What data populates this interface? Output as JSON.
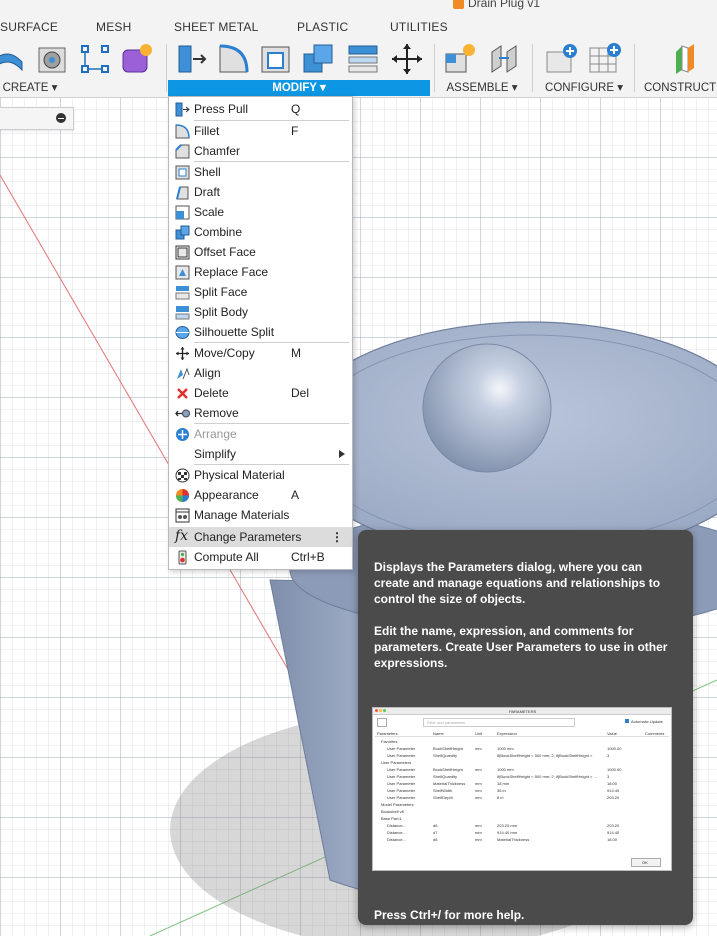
{
  "document": {
    "title": "Drain Plug v1"
  },
  "tabs": [
    "SURFACE",
    "MESH",
    "SHEET METAL",
    "PLASTIC",
    "UTILITIES"
  ],
  "groups": {
    "create": "CREATE ▾",
    "modify": "MODIFY ▾",
    "assemble": "ASSEMBLE ▾",
    "configure": "CONFIGURE ▾",
    "construct": "CONSTRUCT"
  },
  "colors": {
    "accent": "#0d96e3",
    "model": "#a7b6cf",
    "tooltip_bg": "#4b4b4b"
  },
  "menu": {
    "items": [
      {
        "label": "Press Pull",
        "shortcut": "Q",
        "icon": "press-pull-icon"
      },
      {
        "label": "Fillet",
        "shortcut": "F",
        "icon": "fillet-icon"
      },
      {
        "label": "Chamfer",
        "shortcut": "",
        "icon": "chamfer-icon"
      },
      {
        "label": "Shell",
        "shortcut": "",
        "icon": "shell-icon"
      },
      {
        "label": "Draft",
        "shortcut": "",
        "icon": "draft-icon"
      },
      {
        "label": "Scale",
        "shortcut": "",
        "icon": "scale-icon"
      },
      {
        "label": "Combine",
        "shortcut": "",
        "icon": "combine-icon"
      },
      {
        "label": "Offset Face",
        "shortcut": "",
        "icon": "offset-face-icon"
      },
      {
        "label": "Replace Face",
        "shortcut": "",
        "icon": "replace-face-icon"
      },
      {
        "label": "Split Face",
        "shortcut": "",
        "icon": "split-face-icon"
      },
      {
        "label": "Split Body",
        "shortcut": "",
        "icon": "split-body-icon"
      },
      {
        "label": "Silhouette Split",
        "shortcut": "",
        "icon": "silhouette-split-icon"
      },
      {
        "label": "Move/Copy",
        "shortcut": "M",
        "icon": "move-icon"
      },
      {
        "label": "Align",
        "shortcut": "",
        "icon": "align-icon"
      },
      {
        "label": "Delete",
        "shortcut": "Del",
        "icon": "delete-icon"
      },
      {
        "label": "Remove",
        "shortcut": "",
        "icon": "remove-icon"
      },
      {
        "label": "Arrange",
        "shortcut": "",
        "icon": "arrange-icon"
      },
      {
        "label": "Simplify",
        "shortcut": "",
        "icon": "submenu-arrow-icon"
      },
      {
        "label": "Physical Material",
        "shortcut": "",
        "icon": "physical-material-icon"
      },
      {
        "label": "Appearance",
        "shortcut": "A",
        "icon": "appearance-icon"
      },
      {
        "label": "Manage Materials",
        "shortcut": "",
        "icon": "manage-materials-icon"
      },
      {
        "label": "Change Parameters",
        "shortcut": "⋮",
        "icon": "fx-icon"
      },
      {
        "label": "Compute All",
        "shortcut": "Ctrl+B",
        "icon": "compute-all-icon"
      }
    ]
  },
  "tooltip": {
    "p1": "Displays the Parameters dialog, where you can create and manage equations and relationships to control the size of objects.",
    "p2": "Edit the name, expression, and comments for parameters. Create User Parameters to use in other expressions.",
    "footer": "Press Ctrl+/ for more help.",
    "preview": {
      "title": "PARAMETERS",
      "filter_placeholder": "Filter and parameters",
      "auto_update": "Automatic Update",
      "headers": [
        "Parameters",
        "Name",
        "Unit",
        "Expression",
        "Value",
        "Comments"
      ],
      "rows": [
        [
          "Favorites",
          "",
          "",
          "",
          ""
        ],
        [
          "User Parameter",
          "BookShelfHeight",
          "mm",
          "1000 mm",
          "1000.00"
        ],
        [
          "User Parameter",
          "ShelfQuantity",
          "",
          "if(BookShelfHeight < 500 mm; 2; if(BookShelfHeight >",
          "3"
        ],
        [
          "User Parameters",
          "",
          "",
          "",
          ""
        ],
        [
          "User Parameter",
          "BookShelfHeight",
          "mm",
          "1000 mm",
          "1000.00"
        ],
        [
          "User Parameter",
          "ShelfQuantity",
          "",
          "if(BookShelfHeight < 500 mm; 2; if(BookShelfHeight > ...",
          "3"
        ],
        [
          "User Parameter",
          "MaterialThickness",
          "mm",
          "18 mm",
          "18.00"
        ],
        [
          "User Parameter",
          "ShelfWidth",
          "mm",
          "36 in",
          "914.40"
        ],
        [
          "User Parameter",
          "ShelfDepth",
          "mm",
          "8 in",
          "203.20"
        ],
        [
          "Model Parameters",
          "",
          "",
          "",
          ""
        ],
        [
          "Bookshelf v8",
          "",
          "",
          "",
          ""
        ],
        [
          "Base Part:1",
          "",
          "",
          "",
          ""
        ],
        [
          "Distance...",
          "d6",
          "mm",
          "203.20 mm",
          "203.20"
        ],
        [
          "Distance...",
          "d7",
          "mm",
          "914.40 mm",
          "914.40"
        ],
        [
          "Distance...",
          "d8",
          "mm",
          "MaterialThickness",
          "18.00"
        ]
      ],
      "ok": "OK"
    }
  }
}
